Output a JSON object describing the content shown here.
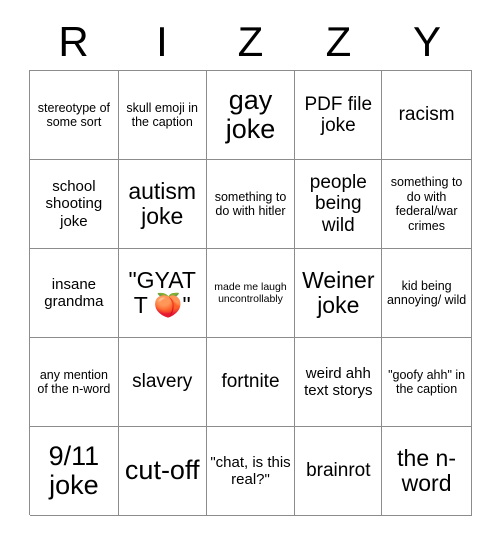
{
  "card": {
    "title": "RIZZY",
    "header_letters": [
      "R",
      "I",
      "Z",
      "Z",
      "Y"
    ],
    "rows": [
      {
        "cells": [
          {
            "text": "stereotype of some sort",
            "size": "sm"
          },
          {
            "text": "skull emoji in the caption",
            "size": "sm"
          },
          {
            "text": "gay joke",
            "size": "xxl"
          },
          {
            "text": "PDF file joke",
            "size": "lg"
          },
          {
            "text": "racism",
            "size": "lg"
          }
        ]
      },
      {
        "cells": [
          {
            "text": "school shooting joke",
            "size": "md"
          },
          {
            "text": "autism joke",
            "size": "xl"
          },
          {
            "text": "something to do with hitler",
            "size": "sm"
          },
          {
            "text": "people being wild",
            "size": "lg"
          },
          {
            "text": "something to do with federal/war crimes",
            "size": "sm"
          }
        ]
      },
      {
        "cells": [
          {
            "text": "insane grandma",
            "size": "md"
          },
          {
            "text": "\"GYATT 🍑\"",
            "size": "xl"
          },
          {
            "text": "made me laugh uncontrollably",
            "size": "xs"
          },
          {
            "text": "Weiner joke",
            "size": "xl"
          },
          {
            "text": "kid being annoying/ wild",
            "size": "sm"
          }
        ]
      },
      {
        "cells": [
          {
            "text": "any mention of the n-word",
            "size": "sm"
          },
          {
            "text": "slavery",
            "size": "lg"
          },
          {
            "text": "fortnite",
            "size": "lg"
          },
          {
            "text": "weird ahh text storys",
            "size": "md"
          },
          {
            "text": "\"goofy ahh\" in the caption",
            "size": "sm"
          }
        ]
      },
      {
        "cells": [
          {
            "text": "9/11 joke",
            "size": "xxl"
          },
          {
            "text": "cut-off",
            "size": "xxl"
          },
          {
            "text": "\"chat, is this real?\"",
            "size": "md"
          },
          {
            "text": "brainrot",
            "size": "lg"
          },
          {
            "text": "the n-word",
            "size": "xl"
          }
        ]
      }
    ]
  },
  "colors": {
    "background": "#ffffff",
    "text": "#000000",
    "grid_line": "#8c8c8c"
  }
}
